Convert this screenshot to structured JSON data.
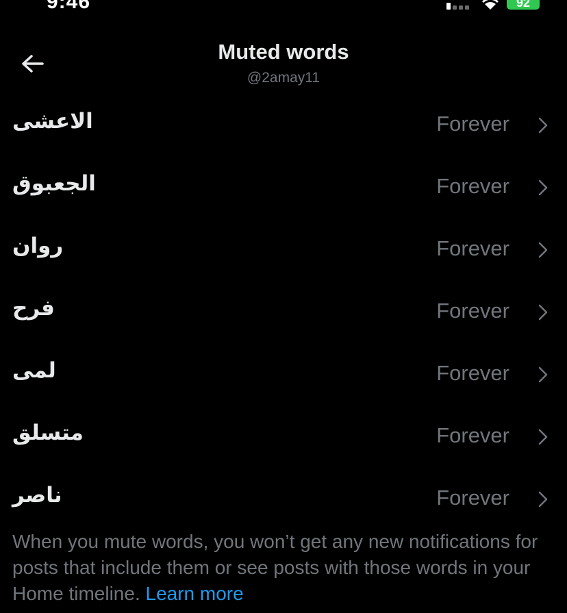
{
  "status_bar": {
    "time": "9:46",
    "battery": "92",
    "battery_color": "#31c852"
  },
  "header": {
    "back_icon": "arrow-left-icon",
    "title": "Muted words",
    "handle": "@2amay11"
  },
  "muted_words": [
    {
      "word": "الاعشى",
      "duration": "Forever"
    },
    {
      "word": "الجعبوق",
      "duration": "Forever"
    },
    {
      "word": "روان",
      "duration": "Forever"
    },
    {
      "word": "فرح",
      "duration": "Forever"
    },
    {
      "word": "لمى",
      "duration": "Forever"
    },
    {
      "word": "متسلق",
      "duration": "Forever"
    },
    {
      "word": "ناصر",
      "duration": "Forever"
    }
  ],
  "footer": {
    "note": "When you mute words, you won’t get any new notifications for posts that include them or see posts with those words in your Home timeline.",
    "link": "Learn more",
    "link_color": "#1d9bf0"
  }
}
